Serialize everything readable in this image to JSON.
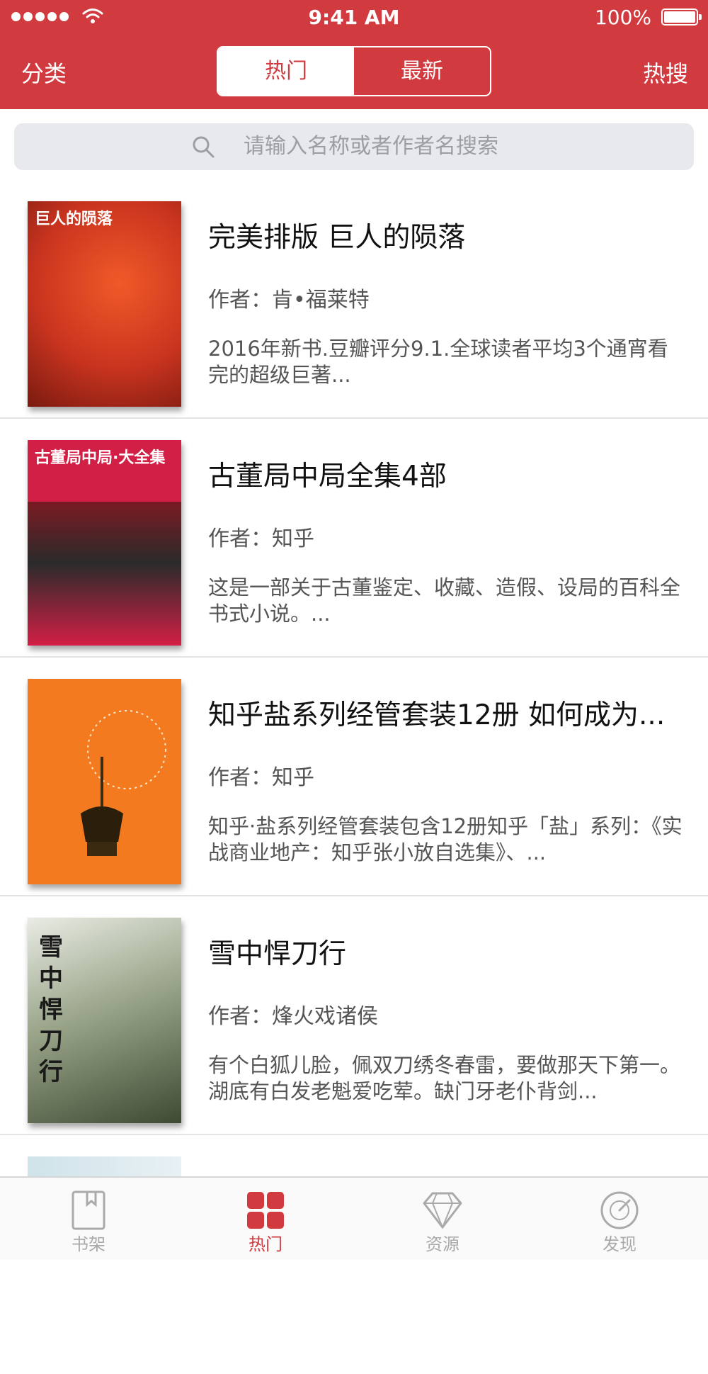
{
  "status_bar": {
    "time": "9:41 AM",
    "battery": "100%"
  },
  "nav": {
    "left": "分类",
    "right": "热搜",
    "segments": [
      {
        "label": "热门",
        "active": true
      },
      {
        "label": "最新",
        "active": false
      }
    ]
  },
  "search": {
    "placeholder": "请输入名称或者作者名搜索"
  },
  "books": [
    {
      "title": "完美排版 巨人的陨落",
      "author": "作者：肯•福莱特",
      "desc": "2016年新书.豆瓣评分9.1.全球读者平均3个通宵看完的超级巨著...",
      "cover_text": "巨人的陨落",
      "cover_color": "#c9341f"
    },
    {
      "title": "古董局中局全集4部",
      "author": "作者：知乎",
      "desc": "这是一部关于古董鉴定、收藏、造假、设局的百科全书式小说。...",
      "cover_text": "古董局中局·大全集",
      "cover_color": "#d21f45"
    },
    {
      "title": "知乎盐系列经管套装12册 如何成为...",
      "author": "作者：知乎",
      "desc": "知乎·盐系列经管套装包含12册知乎「盐」系列：《实战商业地产：知乎张小放自选集》、...",
      "cover_text": "",
      "cover_color": "#f47a1f"
    },
    {
      "title": "雪中悍刀行",
      "author": "作者：烽火戏诸侯",
      "desc": "有个白狐儿脸，佩双刀绣冬春雷，要做那天下第一。湖底有白发老魁爱吃荤。缺门牙老仆背剑...",
      "cover_text": "雪中悍刀行",
      "cover_color": "#5f6b4a"
    }
  ],
  "tabbar": [
    {
      "label": "书架",
      "icon": "bookmark-book-icon",
      "active": false
    },
    {
      "label": "热门",
      "icon": "grid-icon",
      "active": true
    },
    {
      "label": "资源",
      "icon": "diamond-icon",
      "active": false
    },
    {
      "label": "发现",
      "icon": "radar-icon",
      "active": false
    }
  ],
  "colors": {
    "brand": "#d13a3f",
    "tab_inactive": "#aaaaaa"
  }
}
